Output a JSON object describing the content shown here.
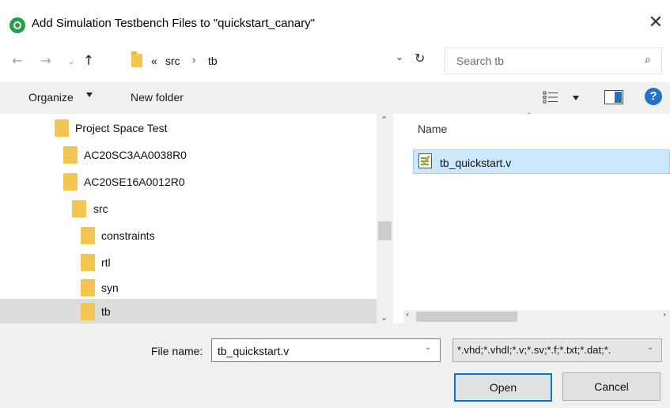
{
  "window": {
    "title": "Add Simulation Testbench Files to \"quickstart_canary\"",
    "close_icon": "close-icon",
    "app_icon": "app-logo-icon"
  },
  "address_bar": {
    "back_icon": "←",
    "forward_icon": "→",
    "recent_icon": "⌄",
    "up_icon": "↑",
    "overflow": "«",
    "breadcrumbs": [
      "src",
      "tb"
    ],
    "separator": "›",
    "dropdown_icon": "⌄",
    "refresh_icon": "↻"
  },
  "search": {
    "placeholder": "Search tb",
    "icon": "⌕"
  },
  "toolbar": {
    "organize_label": "Organize",
    "new_folder_label": "New folder",
    "help_label": "?"
  },
  "nav_tree": {
    "items": [
      {
        "label": "Project Space Test",
        "indent": 1
      },
      {
        "label": "AC20SC3AA0038R0",
        "indent": 2
      },
      {
        "label": "AC20SE16A0012R0",
        "indent": 2
      },
      {
        "label": "src",
        "indent": 3
      },
      {
        "label": "constraints",
        "indent": 4
      },
      {
        "label": "rtl",
        "indent": 4
      },
      {
        "label": "syn",
        "indent": 4
      },
      {
        "label": "tb",
        "indent": 4,
        "selected": true
      }
    ],
    "scroll_up_icon": "⌃",
    "scroll_down_icon": "⌄"
  },
  "file_list": {
    "column_name": "Name",
    "sort_icon": "⌃",
    "files": [
      {
        "name": "tb_quickstart.v",
        "selected": true
      }
    ],
    "scroll_left_icon": "‹",
    "scroll_right_icon": "›"
  },
  "footer": {
    "file_name_label": "File name:",
    "file_name_value": "tb_quickstart.v",
    "file_name_dropdown_icon": "⌄",
    "filter_value": "*.vhd;*.vhdl;*.v;*.sv;*.f;*.txt;*.dat;*.",
    "filter_dropdown_icon": "⌄",
    "open_label": "Open",
    "cancel_label": "Cancel"
  },
  "colors": {
    "accent": "#0078d7",
    "folder": "#f4c553",
    "selection": "#cce8ff",
    "app_logo": "#21a148"
  }
}
